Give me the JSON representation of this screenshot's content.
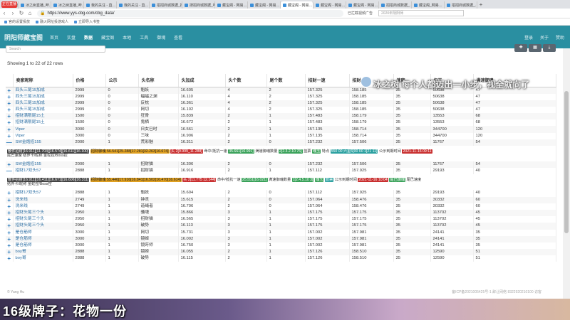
{
  "browser": {
    "tabs": [
      "冰之树直播",
      "冰之树直播_哔…",
      "冰之树直播_哔…",
      "我的关注 - 直…",
      "我的关注 - 直…",
      "招招商城数据_搜…",
      "搜招商城数据_哔…",
      "藏宝阁 - 网易…",
      "藏宝阁 - 网易…",
      "藏宝阁 - 网易…",
      "藏宝阁 - 网易…",
      "藏宝阁 - 网易…",
      "招招商城数据_…",
      "藏宝阁_网易…",
      "招招商城数据_…"
    ],
    "url": "https://www.yys-cbg.com/cbg_data/",
    "ext": [
      "已拦截视频广告",
      "2020年阴阳师"
    ],
    "bookmarks": [
      "官的设置投放",
      "融火网址投游戏人",
      "立即导入书签"
    ]
  },
  "site": {
    "logo": "阴阳师藏宝阁",
    "nav": [
      "首页",
      "数据",
      "实盘",
      "藏宝阁",
      "工具",
      "本地",
      "御魂",
      "查看"
    ],
    "nav_right": [
      "登录",
      "关于",
      "赞助"
    ]
  },
  "main": {
    "search_placeholder": "Search",
    "row_info": "Showing 1 to 22 of 22 rows",
    "columns": [
      "",
      "卖家昵称",
      "价格",
      "公示",
      "头名称",
      "头加成",
      "头个数",
      "尾个数",
      "招财一速",
      "招财一速",
      "速度",
      "勾玉",
      "满速御魂"
    ],
    "rows": [
      [
        "+",
        "四头三尾15加成",
        "2999",
        "0",
        "魁妖",
        "16.605",
        "4",
        "2",
        "157.325",
        "158.185",
        "35",
        "50638",
        "47"
      ],
      [
        "+",
        "四头三尾15加成",
        "2999",
        "0",
        "蝠蝠之渊",
        "16.110",
        "4",
        "2",
        "157.325",
        "158.185",
        "35",
        "50638",
        "47"
      ],
      [
        "+",
        "四头三尾15加成",
        "2999",
        "0",
        "反枕",
        "16.361",
        "4",
        "2",
        "157.325",
        "158.185",
        "35",
        "50638",
        "47"
      ],
      [
        "+",
        "四头三尾15加成",
        "2999",
        "0",
        "网切",
        "16.102",
        "4",
        "2",
        "157.325",
        "158.185",
        "35",
        "50638",
        "47"
      ],
      [
        "+",
        "招财满限尾15土",
        "1500",
        "0",
        "狂骨",
        "15.839",
        "2",
        "1",
        "157.483",
        "158.179",
        "35",
        "13553",
        "68"
      ],
      [
        "+",
        "招财满限尾15土",
        "1500",
        "0",
        "鬼栖",
        "16.672",
        "2",
        "1",
        "157.483",
        "158.179",
        "35",
        "13553",
        "68"
      ],
      [
        "+",
        "Viper",
        "3000",
        "0",
        "日女巳时",
        "16.561",
        "2",
        "1",
        "157.135",
        "158.714",
        "35",
        "344700",
        "120"
      ],
      [
        "+",
        "Viper",
        "3000",
        "0",
        "三味",
        "16.906",
        "2",
        "1",
        "157.135",
        "158.714",
        "35",
        "344700",
        "120"
      ],
      [
        "—",
        "SW金炮招155",
        "2000",
        "1",
        "荒彩魅",
        "16.311",
        "2",
        "0",
        "157.232",
        "157.506",
        "35",
        "11767",
        "54"
      ]
    ],
    "detail1": {
      "line1_label": "散件招财[16.911][11.703][16.574][16.611][16.100]",
      "seg1": "招财御魂 56.541[25.288[17.281[32.263[16.674]",
      "seg2": "头 2[9.999_11.288]",
      "seg3": "命中/抵抗一速",
      "seg4": "35.661[16.991]",
      "seg5": "满速御魂数量",
      "seg6": "2[2.3.2.10 76]",
      "seg7": "蓝票",
      "seg8": "魂玉",
      "seg9": "特点",
      "seg10": "550 00 六星6[00 00 1[21 11]",
      "seg11": "公示到期时间",
      "seg12": "2021-11-16 09:11",
      "line2": "尾巴速度 结界卡/昵称 金蛇控/Boss控"
    },
    "rows2": [
      [
        "+",
        "SW金炮招155",
        "2000",
        "1",
        "招财猫",
        "16.306",
        "2",
        "0",
        "157.232",
        "157.506",
        "35",
        "11767",
        "54"
      ],
      [
        "—",
        "招财17双头57",
        "2888",
        "1",
        "招财猫",
        "16.916",
        "2",
        "1",
        "157.112",
        "157.925",
        "35",
        "29193",
        "40"
      ]
    ],
    "detail2": {
      "line1_label": "散件招财[16.911][16.411][16.671][16.606][16.311]",
      "seg1": "招财御魂 55.446[17.916[16.841[16.502[16.470[16.614]",
      "seg2": "头 2[11.775 12.144]",
      "seg3": "命中/抵抗一速",
      "seg4": "25.551[16.021]",
      "seg5": "满速御魂数量",
      "seg6": "1[2.4.5.10 3]",
      "seg7": "魂玉",
      "seg8": "蓝票",
      "seg9": "公示到期时间",
      "seg10": "2021-11-16 10:04",
      "seg11": "尾巴御魂",
      "seg12": "尾巴速度",
      "line2": "结界卡/昵称 金蛇控/Boss控"
    },
    "rows3": [
      [
        "+",
        "招财17双头57",
        "2888",
        "1",
        "魁妖",
        "15.604",
        "2",
        "0",
        "157.112",
        "157.925",
        "35",
        "29193",
        "40"
      ],
      [
        "+",
        "洗米线",
        "2749",
        "1",
        "钟灵",
        "15.615",
        "2",
        "0",
        "157.064",
        "158.476",
        "35",
        "30332",
        "60"
      ],
      [
        "+",
        "洗米线",
        "2749",
        "1",
        "造绳者",
        "16.706",
        "2",
        "0",
        "157.064",
        "158.476",
        "35",
        "30332",
        "60"
      ],
      [
        "+",
        "招财头尾三个头",
        "2950",
        "1",
        "骚魂",
        "15.866",
        "3",
        "1",
        "157.175",
        "157.175",
        "35",
        "113702",
        "45"
      ],
      [
        "+",
        "招财头尾三个头",
        "2950",
        "1",
        "招财猫",
        "16.565",
        "3",
        "1",
        "157.175",
        "157.175",
        "35",
        "113702",
        "45"
      ],
      [
        "+",
        "招财头尾三个头",
        "2950",
        "1",
        "破势",
        "16.113",
        "3",
        "1",
        "157.175",
        "157.175",
        "35",
        "113702",
        "45"
      ],
      [
        "+",
        "是仓筋师",
        "3000",
        "1",
        "网切",
        "15.731",
        "3",
        "1",
        "157.002",
        "157.981",
        "35",
        "24141",
        "35"
      ],
      [
        "+",
        "是仓筋师",
        "3000",
        "1",
        "镜姬",
        "16.002",
        "3",
        "1",
        "157.002",
        "157.981",
        "35",
        "24141",
        "35"
      ],
      [
        "+",
        "是仓筋师",
        "3000",
        "1",
        "镜莳师",
        "16.750",
        "3",
        "1",
        "157.002",
        "157.981",
        "35",
        "24141",
        "35"
      ],
      [
        "+",
        "boy哥",
        "2888",
        "1",
        "镜姬",
        "16.055",
        "2",
        "1",
        "157.126",
        "158.510",
        "35",
        "12590",
        "51"
      ],
      [
        "+",
        "boy哥",
        "2888",
        "1",
        "破势",
        "16.115",
        "2",
        "1",
        "157.126",
        "158.510",
        "35",
        "12590",
        "51"
      ]
    ],
    "footer_left": "© Yang Hu",
    "footer_right": "备ICP备2021005425号-1   辞让网络 8322920210100   访客"
  },
  "overlay": {
    "streamer": "冰之树",
    "slogan": "每个人都迈出一小步，视全就向了",
    "live_badge": "正在直播",
    "caption": "16级牌子：花物一份"
  }
}
